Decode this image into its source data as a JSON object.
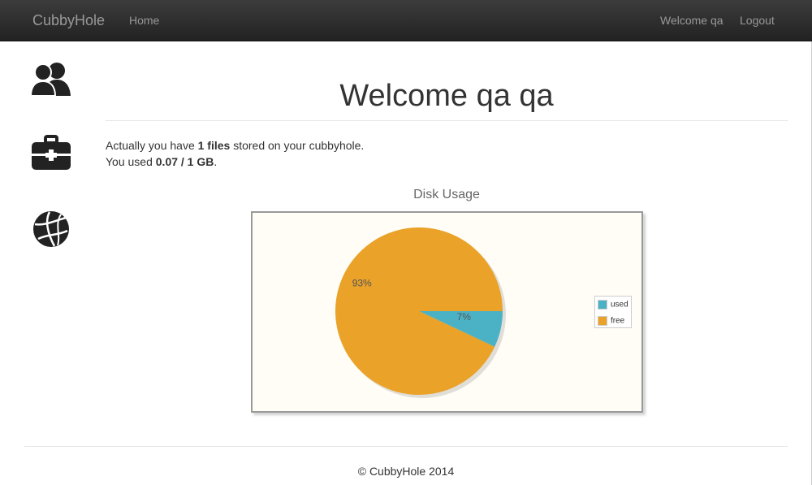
{
  "navbar": {
    "brand": "CubbyHole",
    "home": "Home",
    "welcome": "Welcome qa",
    "logout": "Logout"
  },
  "sidebar": {
    "icons": [
      "users-icon",
      "briefcase-icon",
      "globe-icon"
    ]
  },
  "main": {
    "title": "Welcome qa qa",
    "files_prefix": "Actually you have ",
    "files_value": "1 files",
    "files_suffix": " stored on your cubbyhole.",
    "used_prefix": "You used ",
    "used_value": "0.07 / 1 GB",
    "used_suffix": "."
  },
  "chart_data": {
    "type": "pie",
    "title": "Disk Usage",
    "categories": [
      "used",
      "free"
    ],
    "values": [
      7,
      93
    ],
    "labels": [
      "7%",
      "93%"
    ],
    "colors": [
      "#4bb2c5",
      "#eaa228"
    ],
    "legend": "right"
  },
  "footer": {
    "text": "© CubbyHole 2014"
  }
}
